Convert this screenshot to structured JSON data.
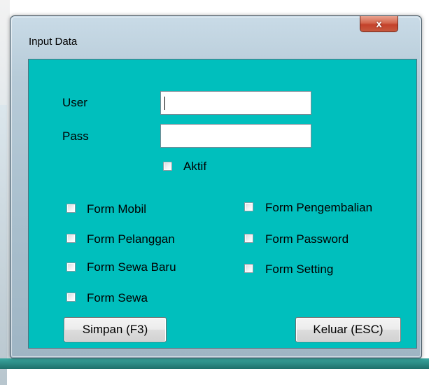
{
  "window": {
    "title": "Input Data",
    "close_glyph": "x",
    "client_bg": "#00bfbd"
  },
  "form": {
    "user_label": "User",
    "user_value": "",
    "pass_label": "Pass",
    "pass_value": "",
    "aktif_label": "Aktif",
    "aktif_checked": false
  },
  "permissions": {
    "left": [
      {
        "label": "Form Mobil",
        "checked": false
      },
      {
        "label": "Form Pelanggan",
        "checked": false
      },
      {
        "label": "Form Sewa Baru",
        "checked": false
      },
      {
        "label": "Form Sewa",
        "checked": false
      }
    ],
    "right": [
      {
        "label": "Form Pengembalian",
        "checked": false
      },
      {
        "label": "Form Password",
        "checked": false
      },
      {
        "label": "Form Setting",
        "checked": false
      }
    ]
  },
  "buttons": {
    "save_label": "Simpan (F3)",
    "exit_label": "Keluar (ESC)"
  }
}
